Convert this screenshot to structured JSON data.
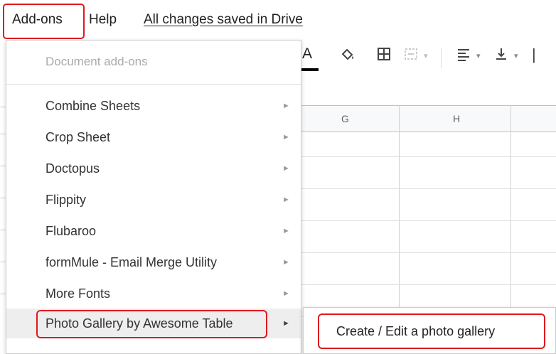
{
  "menubar": {
    "addons_label": "Add-ons",
    "help_label": "Help",
    "saved_status": "All changes saved in Drive"
  },
  "toolbar": {
    "text_color_glyph": "A",
    "fill_icon": "paint-bucket-icon",
    "borders_icon": "borders-icon",
    "merge_icon": "merge-cells-icon",
    "align_icon": "horizontal-align-icon",
    "valign_icon": "vertical-align-icon"
  },
  "grid": {
    "columns": [
      "G",
      "H"
    ]
  },
  "dropdown": {
    "heading": "Document add-ons",
    "items": [
      {
        "label": "Combine Sheets",
        "arrow": "►"
      },
      {
        "label": "Crop Sheet",
        "arrow": "►"
      },
      {
        "label": "Doctopus",
        "arrow": "►"
      },
      {
        "label": "Flippity",
        "arrow": "►"
      },
      {
        "label": "Flubaroo",
        "arrow": "►"
      },
      {
        "label": "formMule - Email Merge Utility",
        "arrow": "►"
      },
      {
        "label": "More Fonts",
        "arrow": "►"
      },
      {
        "label": "Photo Gallery by Awesome Table",
        "arrow": "►"
      }
    ]
  },
  "submenu": {
    "items": [
      {
        "label": "Create / Edit a photo gallery"
      }
    ]
  },
  "colors": {
    "highlight_red": "#e0191f",
    "hover_gray": "#eeeeee"
  }
}
